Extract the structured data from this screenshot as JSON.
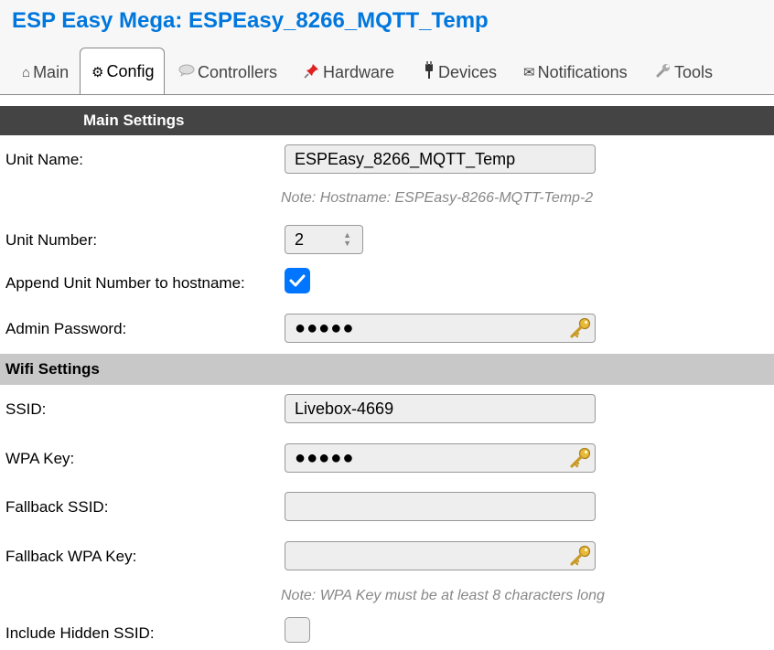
{
  "page": {
    "title": "ESP Easy Mega: ESPEasy_8266_MQTT_Temp"
  },
  "tabs": [
    {
      "label": "Main",
      "icon": "home-icon",
      "glyph": "⌂"
    },
    {
      "label": "Config",
      "icon": "gear-icon",
      "glyph": "⚙"
    },
    {
      "label": "Controllers",
      "icon": "speech-bubble-icon",
      "glyph": ""
    },
    {
      "label": "Hardware",
      "icon": "pushpin-icon",
      "glyph": ""
    },
    {
      "label": "Devices",
      "icon": "plug-icon",
      "glyph": ""
    },
    {
      "label": "Notifications",
      "icon": "envelope-icon",
      "glyph": "✉"
    },
    {
      "label": "Tools",
      "icon": "wrench-icon",
      "glyph": ""
    }
  ],
  "active_tab": "Config",
  "main_settings": {
    "header": "Main Settings",
    "unit_name_label": "Unit Name:",
    "unit_name_value": "ESPEasy_8266_MQTT_Temp",
    "hostname_note": "Note: Hostname: ESPEasy-8266-MQTT-Temp-2",
    "unit_number_label": "Unit Number:",
    "unit_number_value": "2",
    "append_label": "Append Unit Number to hostname:",
    "append_checked": true,
    "admin_password_label": "Admin Password:",
    "admin_password_value": "●●●●●"
  },
  "wifi_settings": {
    "header": "Wifi Settings",
    "ssid_label": "SSID:",
    "ssid_value": "Livebox-4669",
    "wpa_key_label": "WPA Key:",
    "wpa_key_value": "●●●●●",
    "fallback_ssid_label": "Fallback SSID:",
    "fallback_ssid_value": "",
    "fallback_wpa_label": "Fallback WPA Key:",
    "fallback_wpa_value": "",
    "wpa_note": "Note: WPA Key must be at least 8 characters long",
    "hidden_ssid_label": "Include Hidden SSID:",
    "hidden_ssid_checked": false
  },
  "colors": {
    "title": "#0077dd",
    "checkbox_on": "#0075ff",
    "section_dark": "#444444",
    "section_light": "#c8c8c8"
  }
}
